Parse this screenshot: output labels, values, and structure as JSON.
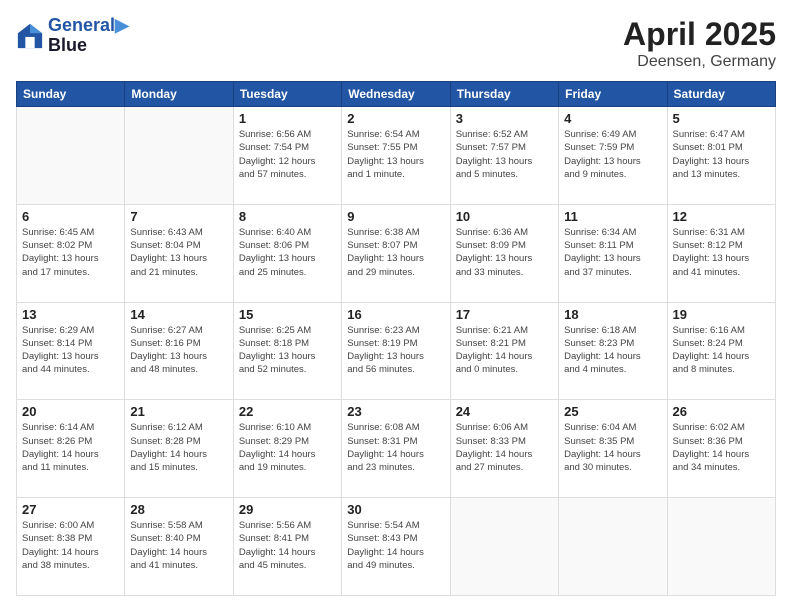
{
  "header": {
    "logo_line1": "General",
    "logo_line2": "Blue",
    "title": "April 2025",
    "subtitle": "Deensen, Germany"
  },
  "weekdays": [
    "Sunday",
    "Monday",
    "Tuesday",
    "Wednesday",
    "Thursday",
    "Friday",
    "Saturday"
  ],
  "weeks": [
    [
      {
        "day": "",
        "info": ""
      },
      {
        "day": "",
        "info": ""
      },
      {
        "day": "1",
        "info": "Sunrise: 6:56 AM\nSunset: 7:54 PM\nDaylight: 12 hours\nand 57 minutes."
      },
      {
        "day": "2",
        "info": "Sunrise: 6:54 AM\nSunset: 7:55 PM\nDaylight: 13 hours\nand 1 minute."
      },
      {
        "day": "3",
        "info": "Sunrise: 6:52 AM\nSunset: 7:57 PM\nDaylight: 13 hours\nand 5 minutes."
      },
      {
        "day": "4",
        "info": "Sunrise: 6:49 AM\nSunset: 7:59 PM\nDaylight: 13 hours\nand 9 minutes."
      },
      {
        "day": "5",
        "info": "Sunrise: 6:47 AM\nSunset: 8:01 PM\nDaylight: 13 hours\nand 13 minutes."
      }
    ],
    [
      {
        "day": "6",
        "info": "Sunrise: 6:45 AM\nSunset: 8:02 PM\nDaylight: 13 hours\nand 17 minutes."
      },
      {
        "day": "7",
        "info": "Sunrise: 6:43 AM\nSunset: 8:04 PM\nDaylight: 13 hours\nand 21 minutes."
      },
      {
        "day": "8",
        "info": "Sunrise: 6:40 AM\nSunset: 8:06 PM\nDaylight: 13 hours\nand 25 minutes."
      },
      {
        "day": "9",
        "info": "Sunrise: 6:38 AM\nSunset: 8:07 PM\nDaylight: 13 hours\nand 29 minutes."
      },
      {
        "day": "10",
        "info": "Sunrise: 6:36 AM\nSunset: 8:09 PM\nDaylight: 13 hours\nand 33 minutes."
      },
      {
        "day": "11",
        "info": "Sunrise: 6:34 AM\nSunset: 8:11 PM\nDaylight: 13 hours\nand 37 minutes."
      },
      {
        "day": "12",
        "info": "Sunrise: 6:31 AM\nSunset: 8:12 PM\nDaylight: 13 hours\nand 41 minutes."
      }
    ],
    [
      {
        "day": "13",
        "info": "Sunrise: 6:29 AM\nSunset: 8:14 PM\nDaylight: 13 hours\nand 44 minutes."
      },
      {
        "day": "14",
        "info": "Sunrise: 6:27 AM\nSunset: 8:16 PM\nDaylight: 13 hours\nand 48 minutes."
      },
      {
        "day": "15",
        "info": "Sunrise: 6:25 AM\nSunset: 8:18 PM\nDaylight: 13 hours\nand 52 minutes."
      },
      {
        "day": "16",
        "info": "Sunrise: 6:23 AM\nSunset: 8:19 PM\nDaylight: 13 hours\nand 56 minutes."
      },
      {
        "day": "17",
        "info": "Sunrise: 6:21 AM\nSunset: 8:21 PM\nDaylight: 14 hours\nand 0 minutes."
      },
      {
        "day": "18",
        "info": "Sunrise: 6:18 AM\nSunset: 8:23 PM\nDaylight: 14 hours\nand 4 minutes."
      },
      {
        "day": "19",
        "info": "Sunrise: 6:16 AM\nSunset: 8:24 PM\nDaylight: 14 hours\nand 8 minutes."
      }
    ],
    [
      {
        "day": "20",
        "info": "Sunrise: 6:14 AM\nSunset: 8:26 PM\nDaylight: 14 hours\nand 11 minutes."
      },
      {
        "day": "21",
        "info": "Sunrise: 6:12 AM\nSunset: 8:28 PM\nDaylight: 14 hours\nand 15 minutes."
      },
      {
        "day": "22",
        "info": "Sunrise: 6:10 AM\nSunset: 8:29 PM\nDaylight: 14 hours\nand 19 minutes."
      },
      {
        "day": "23",
        "info": "Sunrise: 6:08 AM\nSunset: 8:31 PM\nDaylight: 14 hours\nand 23 minutes."
      },
      {
        "day": "24",
        "info": "Sunrise: 6:06 AM\nSunset: 8:33 PM\nDaylight: 14 hours\nand 27 minutes."
      },
      {
        "day": "25",
        "info": "Sunrise: 6:04 AM\nSunset: 8:35 PM\nDaylight: 14 hours\nand 30 minutes."
      },
      {
        "day": "26",
        "info": "Sunrise: 6:02 AM\nSunset: 8:36 PM\nDaylight: 14 hours\nand 34 minutes."
      }
    ],
    [
      {
        "day": "27",
        "info": "Sunrise: 6:00 AM\nSunset: 8:38 PM\nDaylight: 14 hours\nand 38 minutes."
      },
      {
        "day": "28",
        "info": "Sunrise: 5:58 AM\nSunset: 8:40 PM\nDaylight: 14 hours\nand 41 minutes."
      },
      {
        "day": "29",
        "info": "Sunrise: 5:56 AM\nSunset: 8:41 PM\nDaylight: 14 hours\nand 45 minutes."
      },
      {
        "day": "30",
        "info": "Sunrise: 5:54 AM\nSunset: 8:43 PM\nDaylight: 14 hours\nand 49 minutes."
      },
      {
        "day": "",
        "info": ""
      },
      {
        "day": "",
        "info": ""
      },
      {
        "day": "",
        "info": ""
      }
    ]
  ]
}
